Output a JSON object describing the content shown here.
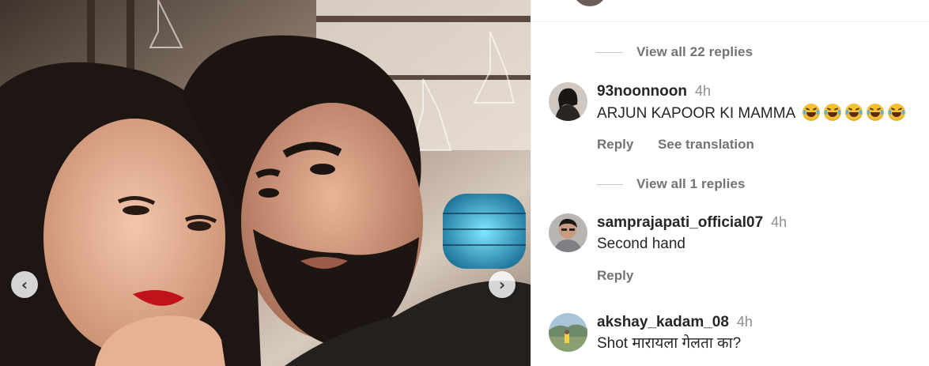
{
  "photo": {
    "prev_icon": "chevron-left-icon",
    "next_icon": "chevron-right-icon",
    "prev_glyph": "‹",
    "next_glyph": "›"
  },
  "comments": {
    "reply_groups": [
      {
        "label": "View all 22 replies"
      },
      {
        "label": "View all 1 replies"
      }
    ],
    "items": [
      {
        "username": "93noonnoon",
        "time": "4h",
        "text": "ARJUN KAPOOR KI MAMMA",
        "emoji": "face-with-tears-of-joy-icon",
        "emoji_count": 5,
        "reply_label": "Reply",
        "translate_label": "See translation"
      },
      {
        "username": "samprajapati_official07",
        "time": "4h",
        "text": "Second hand",
        "reply_label": "Reply"
      },
      {
        "username": "akshay_kadam_08",
        "time": "4h",
        "text": "Shot मारायला गेलता का?"
      }
    ]
  },
  "colors": {
    "text_primary": "#262626",
    "text_secondary": "#737373",
    "timestamp": "#8e8e8e",
    "divider": "#efefef"
  }
}
